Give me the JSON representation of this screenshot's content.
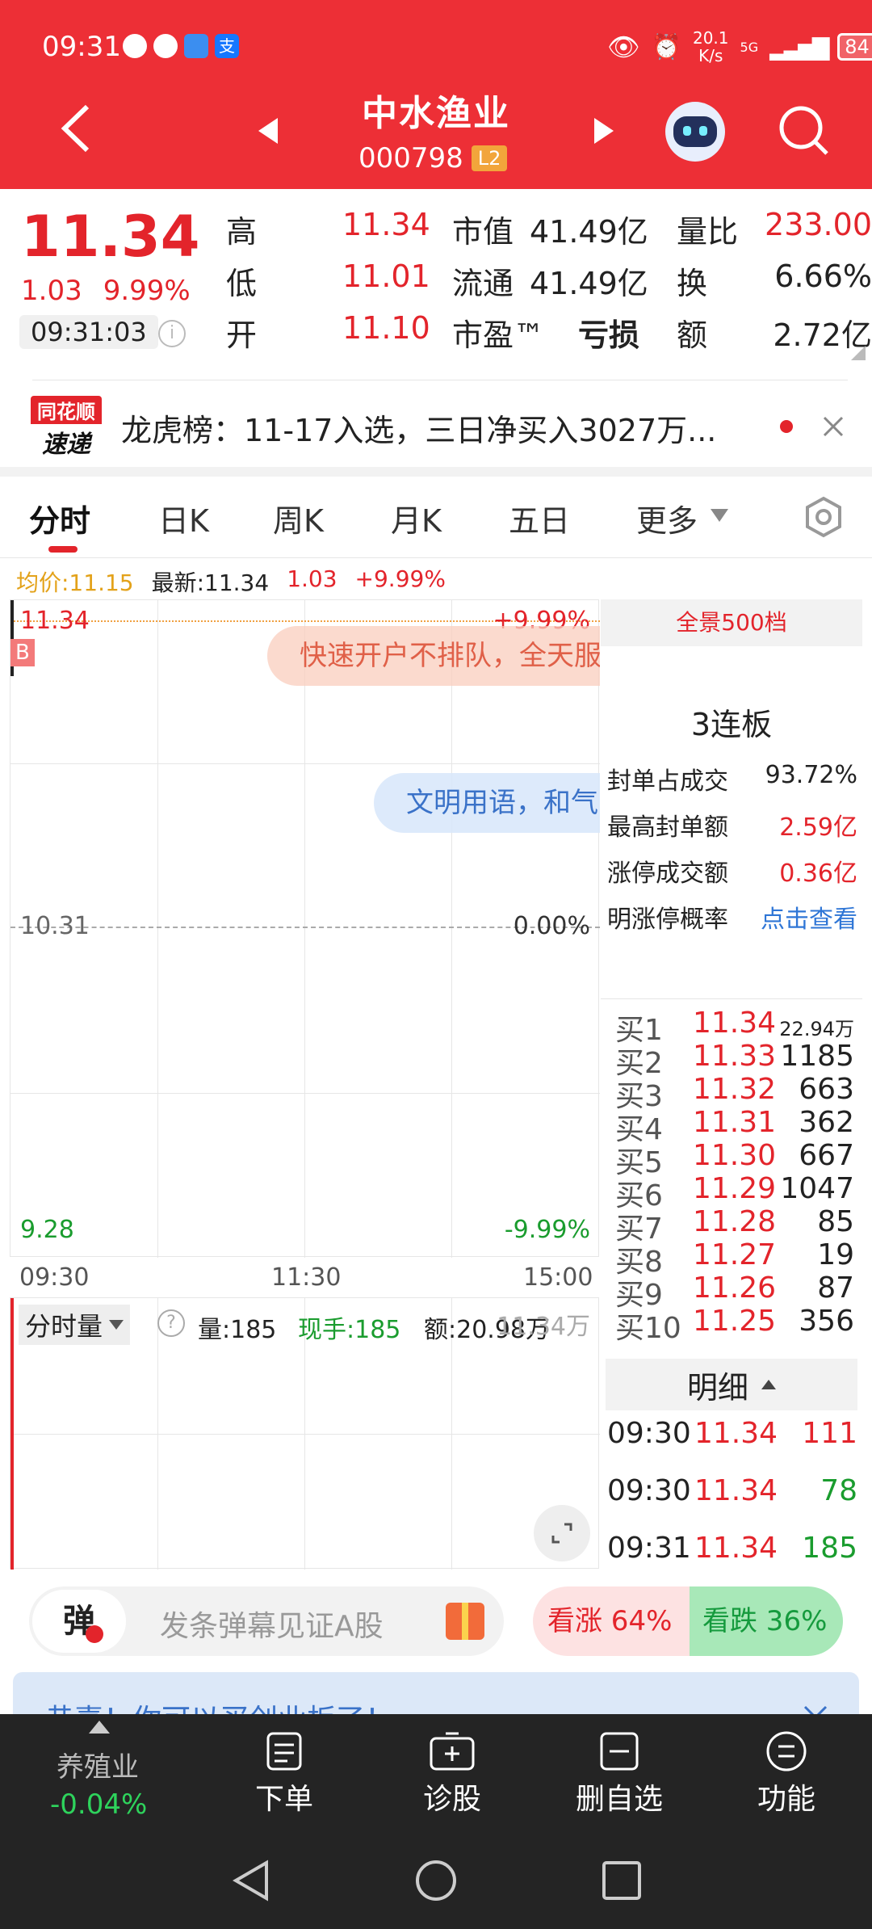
{
  "status": {
    "time": "09:31",
    "speed": "20.1",
    "speed_unit": "K/s",
    "net": "5G",
    "battery": "84"
  },
  "header": {
    "title": "中水渔业",
    "code": "000798",
    "badge": "L2"
  },
  "quote": {
    "price": "11.34",
    "change": "1.03",
    "change_pct": "9.99%",
    "timestamp": "09:31:03",
    "rows": [
      {
        "l1": "高",
        "v1": "11.34",
        "l2": "市值",
        "v2": "41.49亿",
        "l3": "量比",
        "v3": "233.00"
      },
      {
        "l1": "低",
        "v1": "11.01",
        "l2": "流通",
        "v2": "41.49亿",
        "l3": "换",
        "v3": "6.66%"
      },
      {
        "l1": "开",
        "v1": "11.10",
        "l2": "市盈™",
        "v2": "亏损",
        "l3": "额",
        "v3": "2.72亿"
      }
    ]
  },
  "news": {
    "logo_top": "同花顺",
    "logo_bottom": "速递",
    "text": "龙虎榜：11-17入选，三日净买入3027万..."
  },
  "tabs": [
    "分时",
    "日K",
    "周K",
    "月K",
    "五日",
    "更多"
  ],
  "info": {
    "avg": "均价:11.15",
    "latest": "最新:11.34",
    "chg": "1.03",
    "pct": "+9.99%"
  },
  "chart": {
    "top_price": "11.34",
    "top_pct": "+9.99%",
    "mid_price": "10.31",
    "mid_pct": "0.00%",
    "bot_price": "9.28",
    "bot_pct": "-9.99%",
    "t1": "09:30",
    "t2": "11:30",
    "t3": "15:00",
    "b_tag": "B",
    "banner1": "快速开户不排队，全天服",
    "banner2": "文明用语，和气"
  },
  "volume": {
    "selector": "分时量",
    "vol": "量:185",
    "now": "现手:185",
    "amt": "额:20.98万",
    "max": "11.34万"
  },
  "side": {
    "depth_tab": "全景500档",
    "board": "3连板",
    "stats": [
      {
        "label": "封单占成交",
        "value": "93.72%"
      },
      {
        "label": "最高封单额",
        "value": "2.59亿"
      },
      {
        "label": "涨停成交额",
        "value": "0.36亿"
      },
      {
        "label": "明涨停概率",
        "value": "点击查看"
      }
    ],
    "bids": [
      {
        "l": "买1",
        "p": "11.34",
        "v": "22.94万"
      },
      {
        "l": "买2",
        "p": "11.33",
        "v": "1185"
      },
      {
        "l": "买3",
        "p": "11.32",
        "v": "663"
      },
      {
        "l": "买4",
        "p": "11.31",
        "v": "362"
      },
      {
        "l": "买5",
        "p": "11.30",
        "v": "667"
      },
      {
        "l": "买6",
        "p": "11.29",
        "v": "1047"
      },
      {
        "l": "买7",
        "p": "11.28",
        "v": "85"
      },
      {
        "l": "买8",
        "p": "11.27",
        "v": "19"
      },
      {
        "l": "买9",
        "p": "11.26",
        "v": "87"
      },
      {
        "l": "买10",
        "p": "11.25",
        "v": "356"
      }
    ],
    "detail_title": "明细",
    "trades": [
      {
        "t": "09:30",
        "p": "11.34",
        "v": "111"
      },
      {
        "t": "09:30",
        "p": "11.34",
        "v": "78"
      },
      {
        "t": "09:31",
        "p": "11.34",
        "v": "185"
      }
    ]
  },
  "danmu": {
    "icon_char": "弹",
    "placeholder": "发条弹幕见证A股",
    "up": "看涨 64%",
    "down": "看跌 36%"
  },
  "notice": {
    "text": "恭喜！你可以买创业板了！"
  },
  "bottom": {
    "sector": "养殖业",
    "sector_chg": "-0.04%",
    "btns": [
      "下单",
      "诊股",
      "删自选",
      "功能"
    ]
  }
}
